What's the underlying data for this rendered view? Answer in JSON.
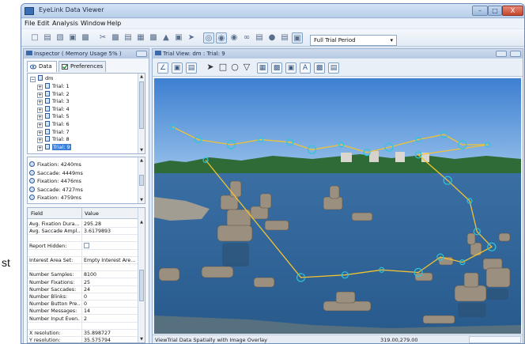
{
  "outside_text": "st",
  "window": {
    "title": "EyeLink Data Viewer",
    "minimize_label": "–",
    "maximize_label": "□",
    "close_label": "X"
  },
  "menu": [
    "File",
    "Edit",
    "Analysis",
    "Window",
    "Help"
  ],
  "toolbar": {
    "period_select": "Full Trial Period",
    "period_arrow": "▾"
  },
  "inspector": {
    "title": "Inspector ( Memory Usage 5% )",
    "tabs": [
      "Data",
      "Preferences"
    ],
    "tree": {
      "root": "dm",
      "trials": [
        "Trial: 1",
        "Trial: 2",
        "Trial: 3",
        "Trial: 4",
        "Trial: 5",
        "Trial: 6",
        "Trial: 7",
        "Trial: 8",
        "Trial: 9"
      ],
      "selected_index": 8
    },
    "events": [
      {
        "label": "Fixation: 4240ms"
      },
      {
        "label": "Saccade: 4449ms"
      },
      {
        "label": "Fixation: 4476ms"
      },
      {
        "label": "Saccade: 4727ms"
      },
      {
        "label": "Fixation: 4759ms"
      }
    ],
    "properties": {
      "headers": [
        "Field",
        "Value"
      ],
      "rows": [
        {
          "field": "Avg. Fixation Dura...",
          "value": "295.28"
        },
        {
          "field": "Avg. Saccade Ampl...",
          "value": "3.6179893"
        },
        {
          "field": "",
          "value": ""
        },
        {
          "field": "Report Hidden:",
          "value": "",
          "checkbox": true
        },
        {
          "field": "",
          "value": ""
        },
        {
          "field": "Interest Area Set:",
          "value": "Empty Interest Are..."
        },
        {
          "field": "",
          "value": ""
        },
        {
          "field": "Number Samples:",
          "value": "8100"
        },
        {
          "field": "Number Fixations:",
          "value": "25"
        },
        {
          "field": "Number Saccades:",
          "value": "24"
        },
        {
          "field": "Number Blinks:",
          "value": "0"
        },
        {
          "field": "Number Button Pre...",
          "value": "0"
        },
        {
          "field": "Number Messages:",
          "value": "14"
        },
        {
          "field": "Number Input Even...",
          "value": "2"
        },
        {
          "field": "",
          "value": ""
        },
        {
          "field": "X resolution:",
          "value": "35.898727"
        },
        {
          "field": "Y resolution:",
          "value": "35.575794"
        }
      ]
    }
  },
  "trial_view": {
    "title": "Trial View: dm : Trial: 9",
    "status_message": "ViewTrial Data Spatially with Image Overlay",
    "status_coords": "319.00,279.00",
    "colors": {
      "scanpath": "#f1c232",
      "fixation": "#2ec6d8"
    },
    "fixations": [
      [
        0.05,
        0.19
      ],
      [
        0.12,
        0.24
      ],
      [
        0.21,
        0.26
      ],
      [
        0.29,
        0.24
      ],
      [
        0.37,
        0.25
      ],
      [
        0.43,
        0.28
      ],
      [
        0.51,
        0.26
      ],
      [
        0.58,
        0.29
      ],
      [
        0.64,
        0.27
      ],
      [
        0.72,
        0.24
      ],
      [
        0.79,
        0.22
      ],
      [
        0.84,
        0.26
      ],
      [
        0.91,
        0.26
      ],
      [
        0.72,
        0.3
      ],
      [
        0.8,
        0.4
      ],
      [
        0.86,
        0.48
      ],
      [
        0.88,
        0.6
      ],
      [
        0.92,
        0.66
      ],
      [
        0.84,
        0.72
      ],
      [
        0.78,
        0.7
      ],
      [
        0.72,
        0.76
      ],
      [
        0.62,
        0.75
      ],
      [
        0.52,
        0.77
      ],
      [
        0.4,
        0.78
      ],
      [
        0.14,
        0.32
      ]
    ]
  }
}
